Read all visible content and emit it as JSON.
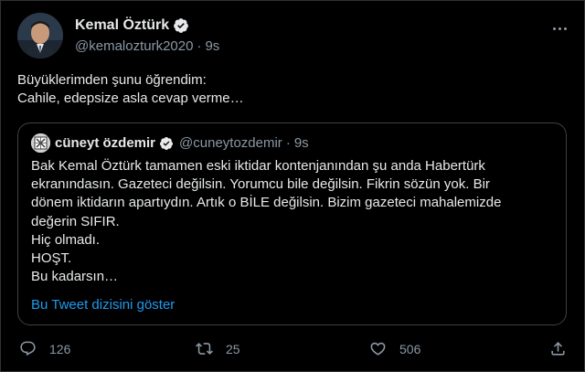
{
  "author": {
    "display_name": "Kemal Öztürk",
    "handle": "@kemalozturk2020",
    "separator": "·",
    "time": "9s",
    "avatar_icon": "user-avatar-photo",
    "verified_icon": "verified-badge-icon"
  },
  "tweet": {
    "lines": [
      "Büyüklerimden şunu öğrendim:",
      "Cahile, edepsize asla cevap verme…"
    ]
  },
  "quote": {
    "display_name": "cüneyt özdemir",
    "handle": "@cuneytozdemir",
    "separator": "·",
    "time": "9s",
    "lines": [
      "Bak Kemal Öztürk tamamen eski iktidar kontenjanından şu anda Habertürk",
      "ekranındasın. Gazeteci değilsin. Yorumcu bile değilsin. Fikrin sözün yok. Bir",
      "dönem iktidarın apartıydın. Artık o BİLE değilsin. Bizim gazeteci mahalemizde",
      "değerin SIFIR.",
      "Hiç olmadı.",
      "HOŞT.",
      "Bu kadarsın…"
    ],
    "show_thread": "Bu Tweet dizisini göster"
  },
  "actions": {
    "reply_count": "126",
    "retweet_count": "25",
    "like_count": "506"
  },
  "colors": {
    "background": "#000000",
    "text": "#e7e9ea",
    "muted": "#8b98a5",
    "link": "#1d9bf0",
    "verified": "#1d9bf0"
  }
}
